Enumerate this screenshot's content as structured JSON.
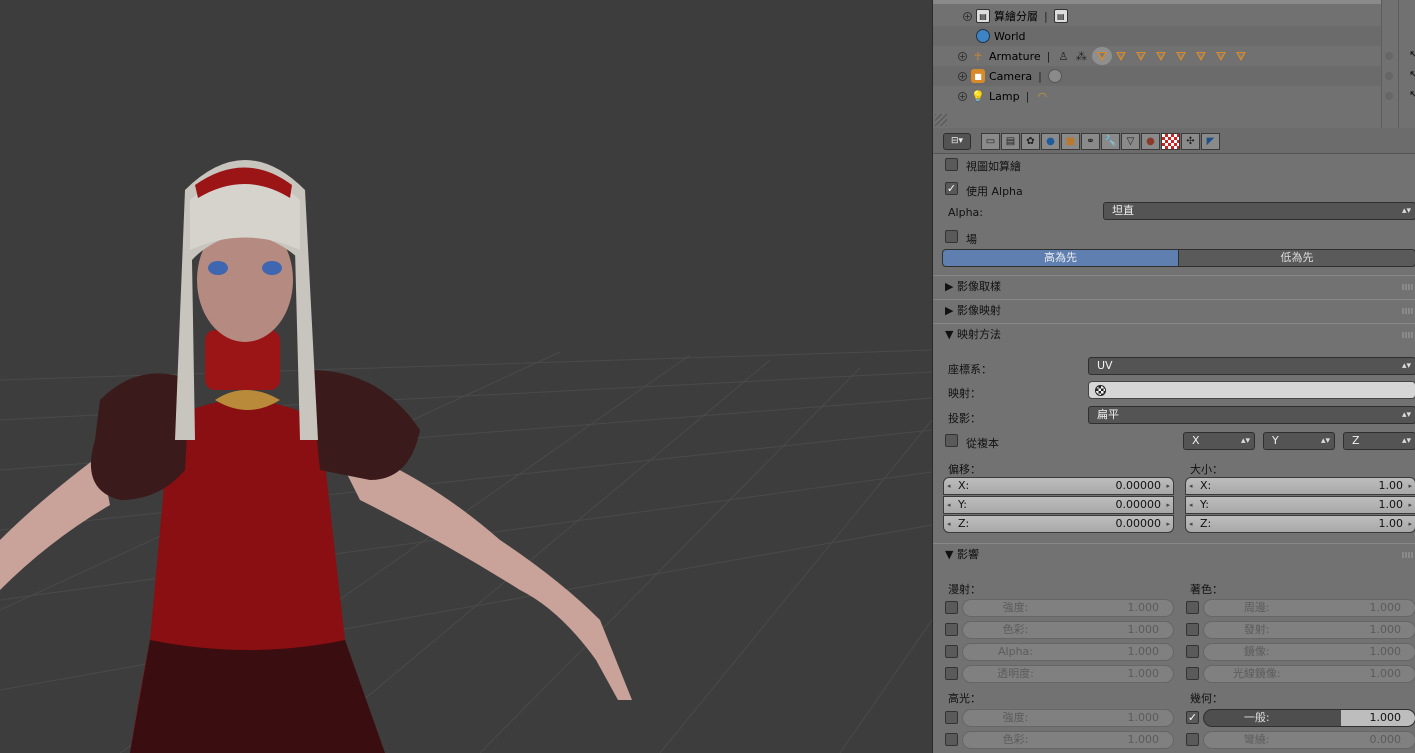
{
  "outliner": {
    "rows": [
      {
        "label": "算繪分層"
      },
      {
        "label": "World"
      },
      {
        "label": "Armature"
      },
      {
        "label": "Camera"
      },
      {
        "label": "Lamp"
      }
    ]
  },
  "props": {
    "tab_select_label": "⊟▾",
    "use_view_as_render": "視圖如算繪",
    "use_alpha": "使用 Alpha",
    "alpha_label": "Alpha:",
    "alpha_value": "坦直",
    "fields_label": "場",
    "order_upper": "高為先",
    "order_lower": "低為先",
    "panel_image_sampling": "影像取樣",
    "panel_image_mapping": "影像映射",
    "panel_mapping": "映射方法",
    "coords_label": "座標系：",
    "coords_value": "UV",
    "map_label": "映射：",
    "projection_label": "投影：",
    "projection_value": "扁平",
    "from_dupli": "從複本",
    "axis_x": "X",
    "axis_y": "Y",
    "axis_z": "Z",
    "offset_label": "偏移：",
    "size_label": "大小：",
    "offset": [
      {
        "k": "X:",
        "v": "0.00000"
      },
      {
        "k": "Y:",
        "v": "0.00000"
      },
      {
        "k": "Z:",
        "v": "0.00000"
      }
    ],
    "size": [
      {
        "k": "X:",
        "v": "1.00"
      },
      {
        "k": "Y:",
        "v": "1.00"
      },
      {
        "k": "Z:",
        "v": "1.00"
      }
    ],
    "panel_influence": "影響",
    "diffuse_label": "漫射：",
    "shading_label": "著色：",
    "specular_label": "高光：",
    "geometry_label": "幾何：",
    "diffuse": [
      {
        "k": "強度:",
        "v": "1.000"
      },
      {
        "k": "色彩:",
        "v": "1.000"
      },
      {
        "k": "Alpha:",
        "v": "1.000"
      },
      {
        "k": "透明度:",
        "v": "1.000"
      }
    ],
    "shading": [
      {
        "k": "周邊:",
        "v": "1.000"
      },
      {
        "k": "發射:",
        "v": "1.000"
      },
      {
        "k": "鏡像:",
        "v": "1.000"
      },
      {
        "k": "光線鏡像:",
        "v": "1.000"
      }
    ],
    "specular": [
      {
        "k": "強度:",
        "v": "1.000"
      },
      {
        "k": "色彩:",
        "v": "1.000"
      }
    ],
    "geometry": [
      {
        "k": "一般:",
        "v": "1.000"
      },
      {
        "k": "彎繞:",
        "v": "0.000"
      }
    ]
  },
  "colors": {
    "viewport_bg": "#3d3d3d",
    "panel_bg": "#727272",
    "accent_blue": "#5e7fb0"
  }
}
